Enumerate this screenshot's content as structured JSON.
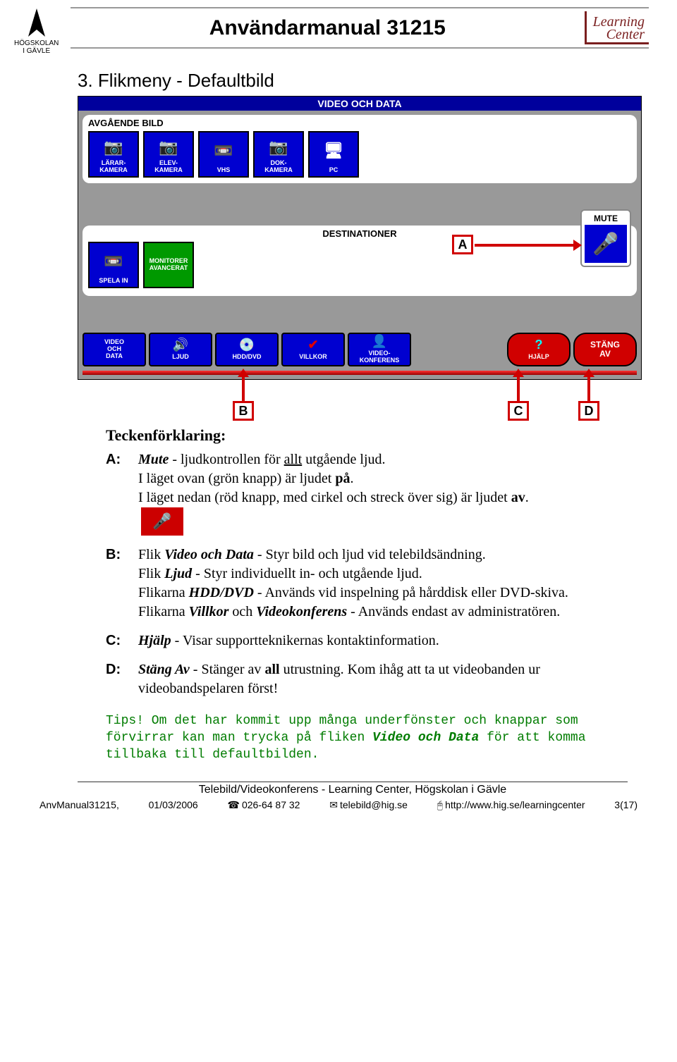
{
  "header": {
    "title": "Användarmanual 31215",
    "left_logo_line1": "HÖGSKOLAN",
    "left_logo_line2": "I GÄVLE",
    "right_logo_line1": "Learning",
    "right_logo_line2": "Center"
  },
  "section_title": "3. Flikmeny - Defaultbild",
  "ui": {
    "title": "VIDEO OCH DATA",
    "panel_out_label": "AVGÅENDE BILD",
    "btns_out": [
      {
        "label": "LÄRAR-\nKAMERA"
      },
      {
        "label": "ELEV-\nKAMERA"
      },
      {
        "label": "VHS"
      },
      {
        "label": "DOK-\nKAMERA"
      },
      {
        "label": "PC"
      }
    ],
    "dest_label": "DESTINATIONER",
    "dest_btns": [
      {
        "label": "SPELA IN"
      },
      {
        "label": "MONITORER\nAVANCERAT",
        "green": true
      }
    ],
    "mute_label": "MUTE",
    "tabs": [
      {
        "label": "VIDEO\nOCH\nDATA",
        "color": "blue"
      },
      {
        "label": "LJUD",
        "color": "blue",
        "icon": "🔊"
      },
      {
        "label": "HDD/DVD",
        "color": "blue",
        "icon": "💿"
      },
      {
        "label": "VILLKOR",
        "color": "blue",
        "icon": "✔"
      },
      {
        "label": "VIDEO-\nKONFERENS",
        "color": "blue",
        "icon": "👤"
      },
      {
        "label": "HJÄLP",
        "color": "red",
        "icon": "?"
      },
      {
        "label": "STÄNG\nAV",
        "color": "red"
      }
    ]
  },
  "callouts": {
    "a": "A",
    "b": "B",
    "c": "C",
    "d": "D"
  },
  "caption": {
    "heading": "Teckenförklaring:",
    "a_key": "A:",
    "a_html": "<b><i>Mute</i></b> - ljudkontrollen för <u>allt</u> utgående ljud.<br>I läget ovan (grön knapp) är ljudet <b>på</b>.<br>I läget nedan (röd knapp, med cirkel och streck över sig) är ljudet <b>av</b>.<br><span class='mic-inline'>🎤</span>",
    "b_key": "B:",
    "b_html": "Flik <b><i>Video och Data</i></b> - Styr bild och ljud vid telebildsändning.<br>Flik <b><i>Ljud</i></b> - Styr individuellt in- och utgående ljud.<br>Flikarna <b><i>HDD/DVD</i></b> - Används vid inspelning på hårddisk eller DVD-skiva.<br>Flikarna <b><i>Villkor</i></b> och <b><i>Videokonferens</i></b> - Används endast av administratören.",
    "c_key": "C:",
    "c_html": "<b><i>Hjälp</i></b> - Visar supportteknikernas kontaktinformation.",
    "d_key": "D:",
    "d_html": "<b><i>Stäng Av</i></b> - Stänger av <b>all</b> utrustning. Kom ihåg att ta ut videobanden ur videobandspelaren först!"
  },
  "tips_html": "Tips! Om det har kommit upp många underfönster och knappar som förvirrar kan man trycka på fliken <b><i>Video och Data</i></b> för att komma tillbaka till defaultbilden.",
  "footer": {
    "line": "Telebild/Videokonferens - Learning Center, Högskolan i Gävle",
    "doc": "AnvManual31215,",
    "date": "01/03/2006",
    "phone": "026-64 87 32",
    "email": "telebild@hig.se",
    "url": "http://www.hig.se/learningcenter",
    "page": "3(17)"
  }
}
